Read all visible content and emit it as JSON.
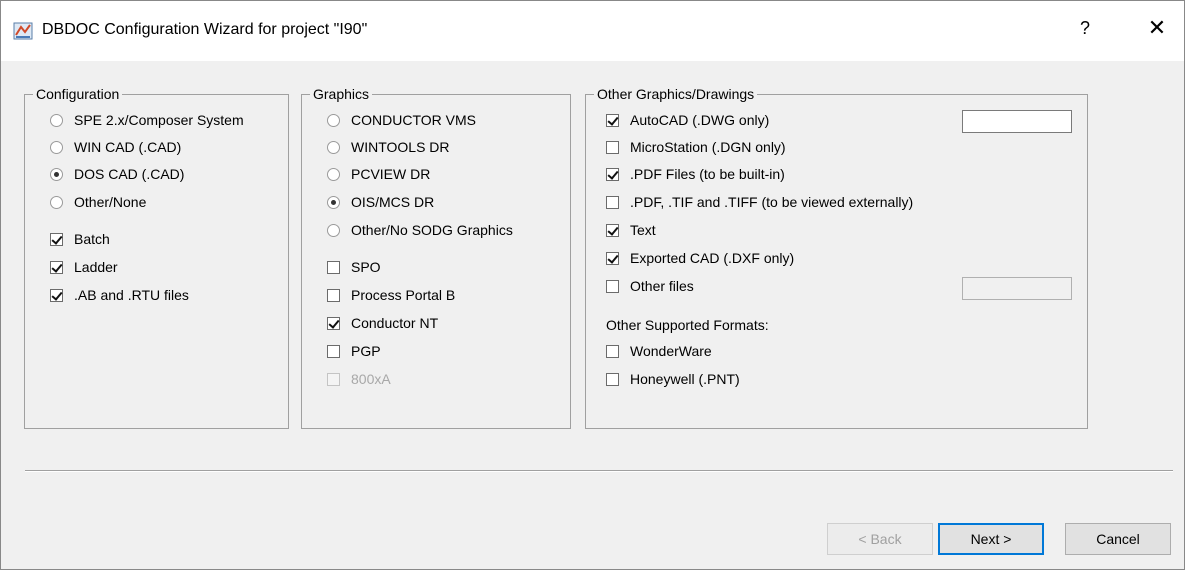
{
  "window": {
    "title": "DBDOC Configuration Wizard for project \"I90\"",
    "help": "?",
    "close": "✕"
  },
  "configuration": {
    "legend": "Configuration",
    "radios": [
      {
        "label": "SPE 2.x/Composer System",
        "checked": false
      },
      {
        "label": "WIN CAD (.CAD)",
        "checked": false
      },
      {
        "label": "DOS CAD (.CAD)",
        "checked": true
      },
      {
        "label": "Other/None",
        "checked": false
      }
    ],
    "checks": [
      {
        "label": "Batch",
        "checked": true
      },
      {
        "label": "Ladder",
        "checked": true
      },
      {
        "label": ".AB and .RTU files",
        "checked": true
      }
    ]
  },
  "graphics": {
    "legend": "Graphics",
    "radios": [
      {
        "label": "CONDUCTOR VMS",
        "checked": false
      },
      {
        "label": "WINTOOLS DR",
        "checked": false
      },
      {
        "label": "PCVIEW DR",
        "checked": false
      },
      {
        "label": "OIS/MCS DR",
        "checked": true
      },
      {
        "label": "Other/No SODG Graphics",
        "checked": false
      }
    ],
    "checks": [
      {
        "label": "SPO",
        "checked": false,
        "disabled": false
      },
      {
        "label": "Process Portal B",
        "checked": false,
        "disabled": false
      },
      {
        "label": "Conductor NT",
        "checked": true,
        "disabled": false
      },
      {
        "label": "PGP",
        "checked": false,
        "disabled": false
      },
      {
        "label": "800xA",
        "checked": false,
        "disabled": true
      }
    ]
  },
  "other": {
    "legend": "Other Graphics/Drawings",
    "checks": [
      {
        "label": "AutoCAD (.DWG only)",
        "checked": true
      },
      {
        "label": "MicroStation (.DGN only)",
        "checked": false
      },
      {
        "label": ".PDF Files (to be built-in)",
        "checked": true
      },
      {
        "label": ".PDF, .TIF and .TIFF (to be viewed externally)",
        "checked": false
      },
      {
        "label": "Text",
        "checked": true
      },
      {
        "label": "Exported CAD (.DXF only)",
        "checked": true
      },
      {
        "label": "Other files",
        "checked": false
      }
    ],
    "autocad_field_value": "",
    "other_files_field_value": "",
    "supported_heading": "Other Supported Formats:",
    "supported": [
      {
        "label": "WonderWare",
        "checked": false
      },
      {
        "label": "Honeywell (.PNT)",
        "checked": false
      }
    ]
  },
  "buttons": {
    "back": "< Back",
    "next": "Next >",
    "cancel": "Cancel"
  }
}
